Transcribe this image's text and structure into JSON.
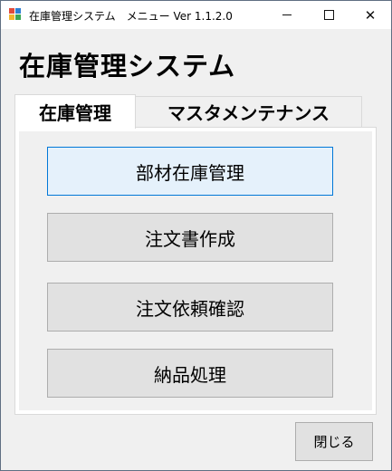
{
  "window": {
    "title": "在庫管理システム　メニュー Ver 1.1.2.0"
  },
  "heading": "在庫管理システム",
  "tabs": [
    {
      "label": "在庫管理",
      "active": true
    },
    {
      "label": "マスタメンテナンス",
      "active": false
    }
  ],
  "menu_buttons": [
    {
      "label": "部材在庫管理",
      "focused": true
    },
    {
      "label": "注文書作成",
      "focused": false
    },
    {
      "label": "注文依頼確認",
      "focused": false
    },
    {
      "label": "納品処理",
      "focused": false
    }
  ],
  "close_button_label": "閉じる",
  "colors": {
    "focus_border": "#0078d7",
    "focus_fill": "#e5f1fb",
    "button_fill": "#e1e1e1",
    "form_background": "#f0f0f0"
  }
}
